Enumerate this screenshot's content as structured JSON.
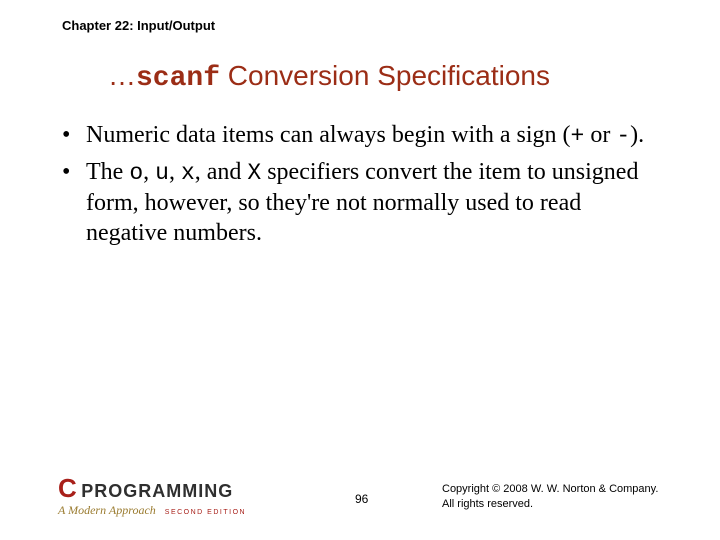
{
  "chapter": "Chapter 22: Input/Output",
  "title": {
    "prefix": "…",
    "code": "scanf",
    "rest": " Conversion Specifications"
  },
  "bullets": [
    {
      "pre": "Numeric data items can always begin with a sign (",
      "m1": "+",
      "mid": " or ",
      "m2": "-",
      "post": ")."
    },
    {
      "pre": "The ",
      "m1": "o",
      "mid1": ", ",
      "m2": "u",
      "mid2": ", ",
      "m3": "x",
      "mid3": ", and ",
      "m4": "X",
      "post": " specifiers convert the item to unsigned form, however, so they're not normally used to read negative numbers."
    }
  ],
  "logo": {
    "c": "C",
    "prog": "PROGRAMMING",
    "sub": "A Modern Approach",
    "edition": "SECOND EDITION"
  },
  "page": "96",
  "copyright": {
    "l1": "Copyright © 2008 W. W. Norton & Company.",
    "l2": "All rights reserved."
  }
}
